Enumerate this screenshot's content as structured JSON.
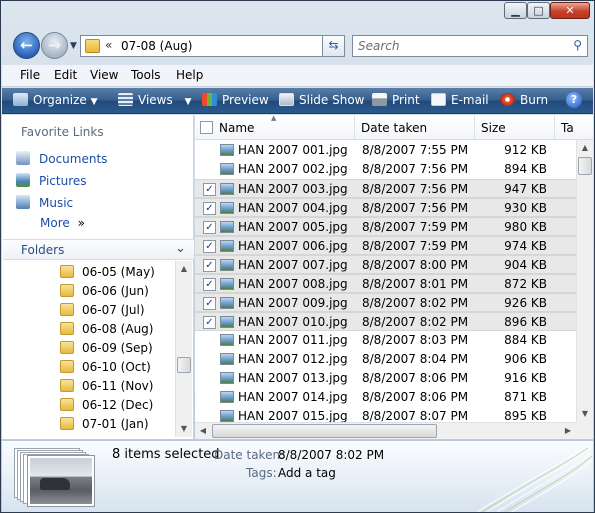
{
  "address": {
    "path": "07-08 (Aug)",
    "search_placeholder": "Search"
  },
  "menu": [
    "File",
    "Edit",
    "View",
    "Tools",
    "Help"
  ],
  "toolbar": {
    "organize": "Organize",
    "views": "Views",
    "preview": "Preview",
    "slideshow": "Slide Show",
    "print": "Print",
    "email": "E-mail",
    "burn": "Burn"
  },
  "favorites": {
    "heading": "Favorite Links",
    "items": [
      "Documents",
      "Pictures",
      "Music"
    ],
    "more": "More"
  },
  "folders": {
    "heading": "Folders",
    "items": [
      "06-05 (May)",
      "06-06 (Jun)",
      "06-07 (Jul)",
      "06-08 (Aug)",
      "06-09 (Sep)",
      "06-10 (Oct)",
      "06-11 (Nov)",
      "06-12 (Dec)",
      "07-01 (Jan)"
    ]
  },
  "columns": {
    "name": "Name",
    "date": "Date taken",
    "size": "Size",
    "tags": "Ta"
  },
  "files": [
    {
      "name": "HAN 2007 001.jpg",
      "date": "8/8/2007 7:55 PM",
      "size": "912 KB",
      "selected": false
    },
    {
      "name": "HAN 2007 002.jpg",
      "date": "8/8/2007 7:56 PM",
      "size": "894 KB",
      "selected": false
    },
    {
      "name": "HAN 2007 003.jpg",
      "date": "8/8/2007 7:56 PM",
      "size": "947 KB",
      "selected": true
    },
    {
      "name": "HAN 2007 004.jpg",
      "date": "8/8/2007 7:56 PM",
      "size": "930 KB",
      "selected": true
    },
    {
      "name": "HAN 2007 005.jpg",
      "date": "8/8/2007 7:59 PM",
      "size": "980 KB",
      "selected": true
    },
    {
      "name": "HAN 2007 006.jpg",
      "date": "8/8/2007 7:59 PM",
      "size": "974 KB",
      "selected": true
    },
    {
      "name": "HAN 2007 007.jpg",
      "date": "8/8/2007 8:00 PM",
      "size": "904 KB",
      "selected": true
    },
    {
      "name": "HAN 2007 008.jpg",
      "date": "8/8/2007 8:01 PM",
      "size": "872 KB",
      "selected": true
    },
    {
      "name": "HAN 2007 009.jpg",
      "date": "8/8/2007 8:02 PM",
      "size": "926 KB",
      "selected": true
    },
    {
      "name": "HAN 2007 010.jpg",
      "date": "8/8/2007 8:02 PM",
      "size": "896 KB",
      "selected": true
    },
    {
      "name": "HAN 2007 011.jpg",
      "date": "8/8/2007 8:03 PM",
      "size": "884 KB",
      "selected": false
    },
    {
      "name": "HAN 2007 012.jpg",
      "date": "8/8/2007 8:04 PM",
      "size": "906 KB",
      "selected": false
    },
    {
      "name": "HAN 2007 013.jpg",
      "date": "8/8/2007 8:06 PM",
      "size": "916 KB",
      "selected": false
    },
    {
      "name": "HAN 2007 014.jpg",
      "date": "8/8/2007 8:06 PM",
      "size": "871 KB",
      "selected": false
    },
    {
      "name": "HAN 2007 015.jpg",
      "date": "8/8/2007 8:07 PM",
      "size": "895 KB",
      "selected": false
    }
  ],
  "details": {
    "count": "8 items selected",
    "date_label": "Date taken:",
    "date_value": "8/8/2007 8:02 PM",
    "tags_label": "Tags:",
    "tags_value": "Add a tag"
  }
}
